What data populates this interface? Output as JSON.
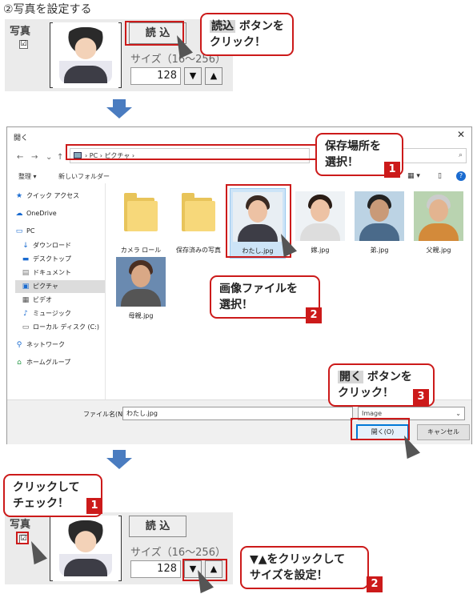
{
  "step_title": "②写真を設定する",
  "photo_setting": {
    "label": "写真",
    "checkbox": "☑",
    "read_button": "読 込",
    "size_label": "サイズ（16～256）",
    "size_label_bottom": "サイズ（16～256）",
    "size_value": "128",
    "down_arrow": "▼",
    "up_arrow": "▲"
  },
  "callouts": {
    "read": {
      "hl": "読込",
      "rest": " ボタンを",
      "line2": "クリック！"
    },
    "location": {
      "text": "保存場所を\n選択！",
      "num": "1"
    },
    "image": {
      "text": "画像ファイルを\n選択！",
      "num": "2"
    },
    "open": {
      "hl": "開く",
      "rest": " ボタンを",
      "line2": "クリック！",
      "num": "3"
    },
    "check": {
      "text": "クリックして\nチェック！",
      "num": "1"
    },
    "size": {
      "text": "▼▲をクリックして\nサイズを設定！",
      "num": "2"
    }
  },
  "dialog": {
    "title": "開く",
    "close": "✕",
    "back": "←",
    "forward": "→",
    "dropdown": "⌄",
    "up": "↑",
    "address": "› PC › ピクチャ ›",
    "address_dropdown": "⌄",
    "refresh": "↻",
    "search_icon": "⌕",
    "toolbar": {
      "organize": "整理 ▾",
      "new_folder": "新しいフォルダー",
      "view": "▦ ▾",
      "pane": "▯",
      "help": "?"
    },
    "nav": [
      {
        "icon": "★",
        "label": "クイック アクセス"
      },
      {
        "icon": "☁",
        "label": "OneDrive"
      },
      {
        "icon": "▭",
        "label": "PC"
      },
      {
        "icon": "↓",
        "label": "ダウンロード"
      },
      {
        "icon": "▬",
        "label": "デスクトップ"
      },
      {
        "icon": "▤",
        "label": "ドキュメント"
      },
      {
        "icon": "▣",
        "label": "ピクチャ"
      },
      {
        "icon": "▦",
        "label": "ビデオ"
      },
      {
        "icon": "♪",
        "label": "ミュージック"
      },
      {
        "icon": "▭",
        "label": "ローカル ディスク (C:)"
      },
      {
        "icon": "⚲",
        "label": "ネットワーク"
      },
      {
        "icon": "⌂",
        "label": "ホームグループ"
      }
    ],
    "files": [
      {
        "name": "カメラ ロール",
        "kind": "folder"
      },
      {
        "name": "保存済みの写真",
        "kind": "folder"
      },
      {
        "name": "わたし.jpg",
        "kind": "photo"
      },
      {
        "name": "嫁.jpg",
        "kind": "photo"
      },
      {
        "name": "弟.jpg",
        "kind": "photo"
      },
      {
        "name": "父親.jpg",
        "kind": "photo"
      },
      {
        "name": "母親.jpg",
        "kind": "photo"
      }
    ],
    "filename_label": "ファイル名(N):",
    "filename_value": "わたし.jpg",
    "filetype": "Image",
    "filetype_dropdown": "⌄",
    "open_button": "開く(O)",
    "cancel_button": "キャンセル"
  },
  "colors": {
    "accent_red": "#cc1a1a",
    "arrow_blue": "#4a7cc0"
  }
}
